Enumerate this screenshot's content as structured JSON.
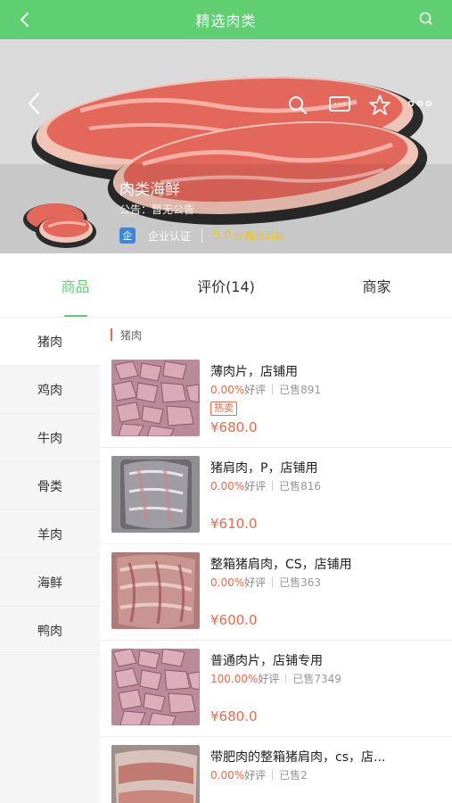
{
  "topbar": {
    "title": "精选肉类",
    "back_icon": "chevron-left-icon",
    "search_icon": "search-icon"
  },
  "banner": {
    "shop_name": "肉类海鲜",
    "notice": "公告：暂无公告",
    "cert_badge": "企",
    "cert_text": "企业认证",
    "score": "5.0",
    "score_unit": "分",
    "score_label": "超出同类",
    "icons": [
      "chevron-left-icon",
      "search-icon",
      "message-icon",
      "star-icon",
      "more-icon"
    ]
  },
  "tabs": [
    {
      "label": "商品",
      "active": true
    },
    {
      "label": "评价(14)",
      "active": false
    },
    {
      "label": "商家",
      "active": false
    }
  ],
  "categories": [
    "猪肉",
    "鸡肉",
    "牛肉",
    "骨类",
    "羊肉",
    "海鲜",
    "鸭肉"
  ],
  "section_title": "猪肉",
  "products": [
    {
      "name": "薄肉片，店铺用",
      "pct": "0.00%",
      "good": "好评",
      "sold": "已售891",
      "tag": "热卖",
      "price": "¥680.0"
    },
    {
      "name": "猪肩肉，P，店铺用",
      "pct": "0.00%",
      "good": "好评",
      "sold": "已售816",
      "tag": "",
      "price": "¥610.0"
    },
    {
      "name": "整箱猪肩肉，CS，店铺用",
      "pct": "0.00%",
      "good": "好评",
      "sold": "已售363",
      "tag": "",
      "price": "¥600.0"
    },
    {
      "name": "普通肉片，店铺专用",
      "pct": "100.00%",
      "good": "好评",
      "sold": "已售7349",
      "tag": "",
      "price": "¥680.0"
    },
    {
      "name": "带肥肉的整箱猪肩肉，cs，店...",
      "pct": "0.00%",
      "good": "好评",
      "sold": "已售2",
      "tag": "",
      "price": ""
    }
  ],
  "colors": {
    "accent": "#5fcf72",
    "price": "#ef6a4a",
    "score": "#f0c419",
    "cert": "#3b86e0"
  }
}
